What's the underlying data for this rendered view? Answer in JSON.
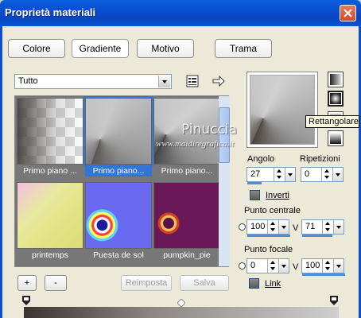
{
  "window": {
    "title": "Proprietà materiali"
  },
  "tabs": [
    {
      "label": "Colore"
    },
    {
      "label": "Gradiente"
    },
    {
      "label": "Motivo"
    },
    {
      "label": "Trama"
    }
  ],
  "filter": {
    "selected": "Tutto"
  },
  "gallery": [
    {
      "label": "Primo piano ...",
      "selected": false
    },
    {
      "label": "Primo piano...",
      "selected": true
    },
    {
      "label": "Primo piano...",
      "selected": false
    },
    {
      "label": "printemps",
      "selected": false
    },
    {
      "label": "Puesta de sol",
      "selected": false
    },
    {
      "label": "pumpkin_pie",
      "selected": false
    }
  ],
  "buttons": {
    "add": "+",
    "remove": "-",
    "reset": "Reimposta",
    "save": "Salva"
  },
  "tooltip": "Rettangolare",
  "watermark": {
    "name": "Pinuccia",
    "url": "www.maidiregrafica.it"
  },
  "angle": {
    "label": "Angolo",
    "value": "27"
  },
  "repeats": {
    "label": "Ripetizioni",
    "value": "0"
  },
  "invert": {
    "label": "Inverti",
    "checked": false
  },
  "center_point": {
    "label": "Punto centrale",
    "x": "100",
    "y_axis": "V",
    "y": "71"
  },
  "focal_point": {
    "label": "Punto focale",
    "x": "0",
    "y_axis": "V",
    "y": "100"
  },
  "link": {
    "label": "Link",
    "checked": false
  },
  "colors": {
    "titlebar": "#0a4dd0",
    "accent": "#3375d6"
  },
  "icons": {
    "swatch_panel": "swatch-list-icon",
    "swap": "arrow-right-icon",
    "close": "close-icon"
  }
}
